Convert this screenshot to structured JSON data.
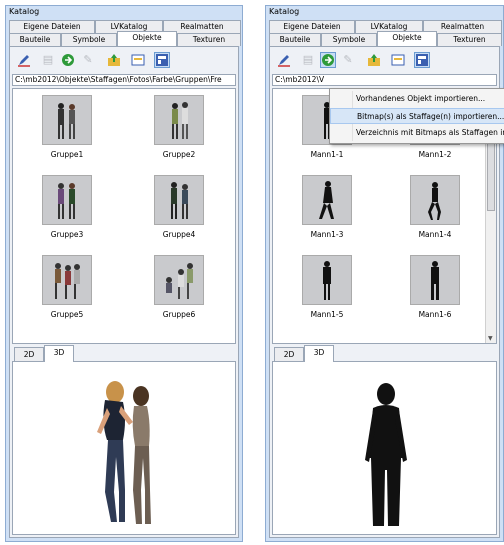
{
  "left": {
    "title": "Katalog",
    "tabs_row1": [
      "Eigene Dateien",
      "LVKatalog",
      "Realmatten"
    ],
    "tabs_row2": [
      "Bauteile",
      "Symbole",
      "Objekte",
      "Texturen"
    ],
    "active_tab": "Objekte",
    "path": "C:\\mb2012\\Objekte\\Staffagen\\Fotos\\Farbe\\Gruppen\\Fre",
    "items": [
      "Gruppe1",
      "Gruppe2",
      "Gruppe3",
      "Gruppe4",
      "Gruppe5",
      "Gruppe6"
    ],
    "view_tabs": [
      "2D",
      "3D"
    ],
    "active_view_tab": "3D"
  },
  "right": {
    "title": "Katalog",
    "tabs_row1": [
      "Eigene Dateien",
      "LVKatalog",
      "Realmatten"
    ],
    "tabs_row2": [
      "Bauteile",
      "Symbole",
      "Objekte",
      "Texturen"
    ],
    "active_tab": "Objekte",
    "path": "C:\\mb2012\\V",
    "items": [
      "Mann1-1",
      "Mann1-2",
      "Mann1-3",
      "Mann1-4",
      "Mann1-5",
      "Mann1-6"
    ],
    "view_tabs": [
      "2D",
      "3D"
    ],
    "active_view_tab": "3D",
    "context_menu": [
      "Vorhandenes Objekt importieren...",
      "Bitmap(s) als Staffage(n) importieren...",
      "Verzeichnis mit Bitmaps als Staffagen im"
    ],
    "highlighted_menu_index": 1
  },
  "toolbar_icons": [
    "pen-icon",
    "document-icon",
    "import-arrow-icon",
    "edit-icon",
    "up-folder-icon",
    "properties-icon",
    "view-icon"
  ],
  "colors": {
    "panel_bg": "#cfe0f5",
    "border": "#9aa6b6",
    "selected_tool": "#c7ddf5",
    "menu_highlight": "#d7e6f7",
    "silhouette": "#111111"
  }
}
